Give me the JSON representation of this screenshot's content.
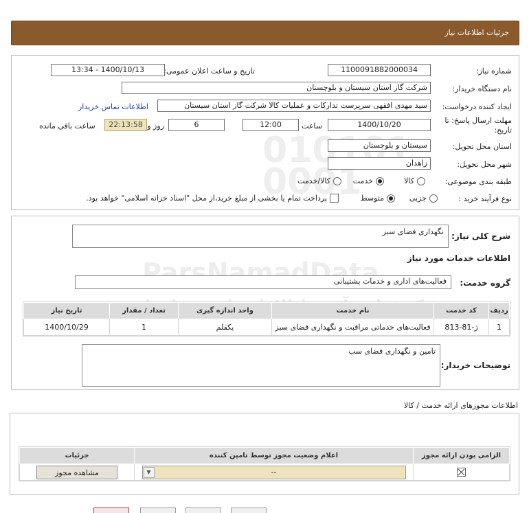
{
  "header": {
    "title": "جزئیات اطلاعات نیاز"
  },
  "form": {
    "need_number_label": "شماره نیاز:",
    "need_number": "1100091882000034",
    "announce_label": "تاریخ و ساعت اعلان عمومی:",
    "announce_value": "1400/10/13 - 13:34",
    "buyer_org_label": "نام دستگاه خریدار:",
    "buyer_org": "شرکت گاز استان سیستان و بلوچستان",
    "creator_label": "ایجاد کننده درخواست:",
    "creator": "سید مهدی افقهی سرپرست تدارکات و عملیات کالا شرکت گاز استان سیستان",
    "contact_link": "اطلاعات تماس خریدار",
    "deadline_label_1": "مهلت ارسال پاسخ: تا",
    "deadline_label_2": "تاریخ:",
    "deadline_date": "1400/10/20",
    "time_label": "ساعت",
    "deadline_time": "12:00",
    "days_value": "6",
    "days_label": "روز و",
    "remaining_time": "22:13:58",
    "remaining_label": "ساعت باقی مانده",
    "province_label": "استان محل تحویل:",
    "province": "سیستان و بلوچستان",
    "city_label": "شهر محل تحویل:",
    "city": "زاهدان",
    "category_label": "طبقه بندی موضوعی:",
    "category_options": [
      "کالا",
      "خدمت",
      "کالا/خدمت"
    ],
    "process_label": "نوع فرآیند خرید :",
    "process_options": [
      "جزیی",
      "متوسط"
    ],
    "payment_note": "پرداخت تمام یا بخشی از مبلغ خرید،از محل \"اسناد خزانه اسلامی\" خواهد بود."
  },
  "summary": {
    "label": "شرح کلی نیاز:",
    "value": "نگهداری فضای سبز",
    "services_heading": "اطلاعات خدمات مورد نیاز",
    "group_label": "گروه خدمت:",
    "group_value": "فعالیت‌های اداری و خدمات پشتیبانی"
  },
  "services_table": {
    "headers": [
      "ردیف",
      "کد خدمت",
      "نام خدمت",
      "واحد اندازه گیری",
      "تعداد / مقدار",
      "تاریخ نیاز"
    ],
    "rows": [
      [
        "1",
        "ژ-81-813",
        "فعالیت‌های خدماتی مراقبت و نگهداری فضای سبز",
        "یکقلم",
        "1",
        "1400/10/29"
      ]
    ]
  },
  "buyer_notes": {
    "label": "توضیحات خریدار:",
    "value": "تامین و نگهداری فضای سب"
  },
  "permits": {
    "heading": "اطلاعات مجوزهای ارائه خدمت / کالا",
    "headers": [
      "الزامی بودن ارائه مجوز",
      "اعلام وضعیت مجوز توسط تامین کننده",
      "جزئیات"
    ],
    "select_value": "--",
    "view_button": "مشاهده مجوز"
  },
  "watermark": {
    "brand": "ParsNamadData",
    "phone": "۰۲۱-۸۸۳۴۹۶۷۰-۵",
    "line1": "مرکز فراهم آوری اطلاعات پارس نماد داده",
    "line2": "پایگاه خبر رسانی مناقصه و مزایده"
  },
  "colors": {
    "title_bg": "#8a5a2c",
    "remaining_bg": "#ede3bc",
    "link": "#1a3fa6"
  }
}
